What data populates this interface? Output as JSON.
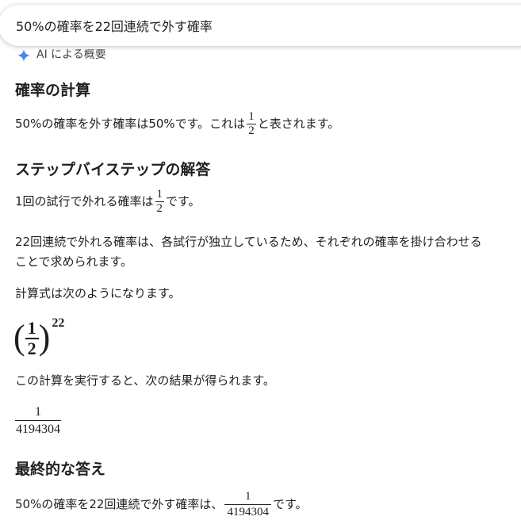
{
  "search": {
    "query": "50%の確率を22回連続で外す確率"
  },
  "ai_overview": {
    "label": "AI による概要",
    "icon": "sparkle-icon",
    "accent": "#4285f4"
  },
  "sec1": {
    "title": "確率の計算",
    "line_prefix": "50%の確率を外す確率は50%です。これは",
    "frac_num": "1",
    "frac_den": "2",
    "line_suffix": "と表されます。"
  },
  "sec2": {
    "title": "ステップバイステップの解答",
    "p1_prefix": "1回の試行で外れる確率は",
    "p1_frac_num": "1",
    "p1_frac_den": "2",
    "p1_suffix": "です。",
    "p2_line1": "22回連続で外れる確率は、各試行が独立しているため、それぞれの確率を掛け合わせる",
    "p2_line2": "ことで求められます。",
    "p3": "計算式は次のようになります。",
    "formula": {
      "open": "(",
      "num": "1",
      "den": "2",
      "close": ")",
      "exponent": "22"
    },
    "p4": "この計算を実行すると、次の結果が得られます。",
    "result": {
      "num": "1",
      "den": "4194304"
    }
  },
  "sec3": {
    "title": "最終的な答え",
    "prefix": "50%の確率を22回連続で外す確率は、",
    "frac_num": "1",
    "frac_den": "4194304",
    "suffix": "です。"
  }
}
